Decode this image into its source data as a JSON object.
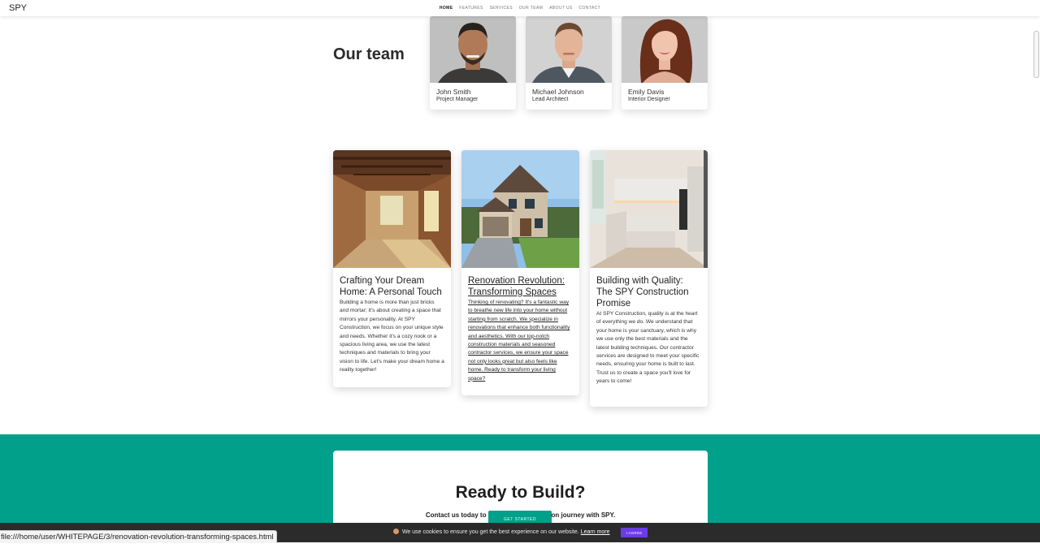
{
  "nav": {
    "brand": "SPY",
    "links": [
      "HOME",
      "FEATURES",
      "SERVICES",
      "OUR TEAM",
      "ABOUT US",
      "CONTACT"
    ],
    "active_index": 0
  },
  "team": {
    "title": "Our team",
    "members": [
      {
        "name": "John Smith",
        "role": "Project Manager"
      },
      {
        "name": "Michael Johnson",
        "role": "Lead Architect"
      },
      {
        "name": "Emily Davis",
        "role": "Interior Designer"
      }
    ]
  },
  "blog": {
    "cards": [
      {
        "title": "Crafting Your Dream Home: A Personal Touch",
        "text": "Building a home is more than just bricks and mortar; it's about creating a space that mirrors your personality. At SPY Construction, we focus on your unique style and needs. Whether it's a cozy nook or a spacious living area, we use the latest techniques and materials to bring your vision to life. Let's make your dream home a reality together!"
      },
      {
        "title": "Renovation Revolution: Transforming Spaces",
        "text": "Thinking of renovating? It's a fantastic way to breathe new life into your home without starting from scratch. We specialize in renovations that enhance both functionality and aesthetics. With our top-notch construction materials and seasoned contractor services, we ensure your space not only looks great but also feels like home. Ready to transform your living space?"
      },
      {
        "title": "Building with Quality: The SPY Construction Promise",
        "text": "At SPY Construction, quality is at the heart of everything we do. We understand that your home is your sanctuary, which is why we use only the best materials and the latest building techniques. Our contractor services are designed to meet your specific needs, ensuring your home is built to last. Trust us to create a space you'll love for years to come!"
      }
    ]
  },
  "cta": {
    "title": "Ready to Build?",
    "subtitle": "Contact us today to start your construction journey with SPY.",
    "button": "GET STARTED"
  },
  "cookie": {
    "text": "We use cookies to ensure you get the best experience on our website.",
    "link": "Learn more",
    "button": "I AGREE"
  },
  "status_url": "file:///home/user/WHITEPAGE/3/renovation-revolution-transforming-spaces.html",
  "colors": {
    "accent": "#00a08a",
    "cookie_button": "#6c3be8",
    "cookie_bar": "#2b2b2b"
  }
}
